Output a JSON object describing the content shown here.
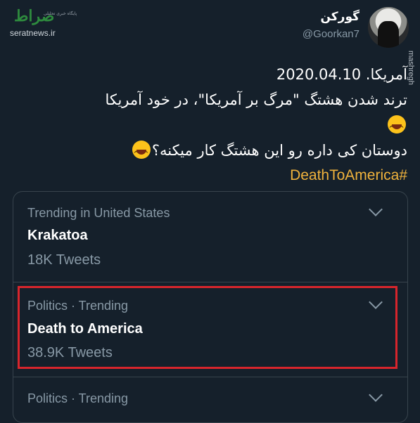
{
  "watermark": {
    "logo_text": "صراط",
    "tagline": "پایگاه خبری تحلیلی",
    "site": "seratnews.ir"
  },
  "tweet": {
    "display_name": "گورکن",
    "handle": "@Goorkan7",
    "side_watermark": "mashregh",
    "lines": [
      "آمریکا. 2020.04.10",
      "ترند شدن هشتگ \"مرگ بر آمریکا\"، در خود آمریکا",
      "دوستان کی داره رو این هشتگ کار میکنه؟"
    ],
    "hashtag": "#DeathToAmerica",
    "emoji_icons": [
      "grinning-squinting-face-icon",
      "grinning-squinting-face-icon"
    ]
  },
  "trends": [
    {
      "context": "Trending in United States",
      "name": "Krakatoa",
      "count": "18K Tweets",
      "highlighted": false
    },
    {
      "context": "Politics · Trending",
      "name": "Death to America",
      "count": "38.9K Tweets",
      "highlighted": true
    },
    {
      "context": "Politics · Trending",
      "name": "",
      "count": "",
      "highlighted": false
    }
  ],
  "colors": {
    "background": "#15202b",
    "hashtag": "#f0b23c",
    "secondary_text": "#8899a6",
    "highlight_border": "#d7252c",
    "watermark_logo": "#2e8b3e"
  }
}
